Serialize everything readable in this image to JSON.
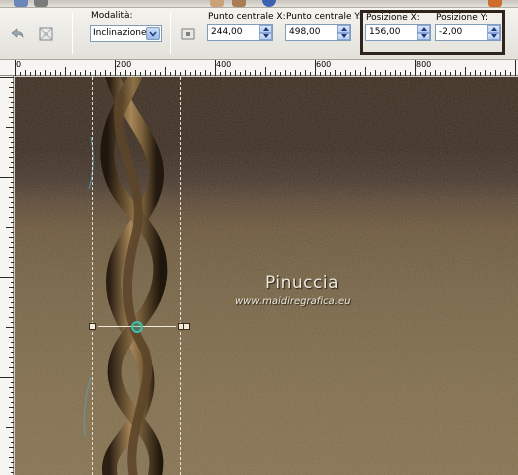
{
  "options": {
    "mode_label": "Modalità:",
    "mode_value": "Inclinazione",
    "center_x_label": "Punto centrale X:",
    "center_x_value": "244,00",
    "center_y_label": "Punto centrale Y:",
    "center_y_value": "498,00",
    "pos_x_label": "Posizione X:",
    "pos_x_value": "156,00",
    "pos_y_label": "Posizione Y:",
    "pos_y_value": "-2,00"
  },
  "ruler": {
    "labels": [
      "0",
      "200",
      "400",
      "600",
      "800"
    ]
  },
  "watermark": {
    "title": "Pinuccia",
    "url": "www.maidiregrafica.eu"
  },
  "colors": {
    "highlight_box": "#2e241c",
    "canvas_dark": "#3b2b1d",
    "canvas_light": "#85704d",
    "pivot": "#3fbfae"
  }
}
